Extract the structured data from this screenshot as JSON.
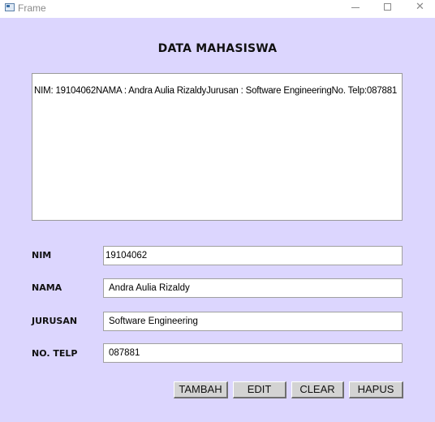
{
  "window": {
    "title": "Frame",
    "minimize_glyph": "—",
    "maximize_glyph": "□",
    "close_glyph": "✕"
  },
  "main": {
    "heading": "DATA MAHASISWA",
    "output_text": "NIM: 19104062NAMA : Andra Aulia RizaldyJurusan : Software EngineeringNo. Telp:087881"
  },
  "form": {
    "nim_label": "NIM",
    "nim_value": "19104062",
    "nama_label": "NAMA",
    "nama_value": "Andra Aulia Rizaldy",
    "jurusan_label": "JURUSAN",
    "jurusan_value": "Software Engineering",
    "telp_label": "NO. TELP",
    "telp_value": "087881"
  },
  "buttons": {
    "tambah": "TAMBAH",
    "edit": "EDIT",
    "clear": "CLEAR",
    "hapus": "HAPUS"
  },
  "colors": {
    "panel_background": "#dcd6fe",
    "button_face": "#d3d3d3"
  }
}
